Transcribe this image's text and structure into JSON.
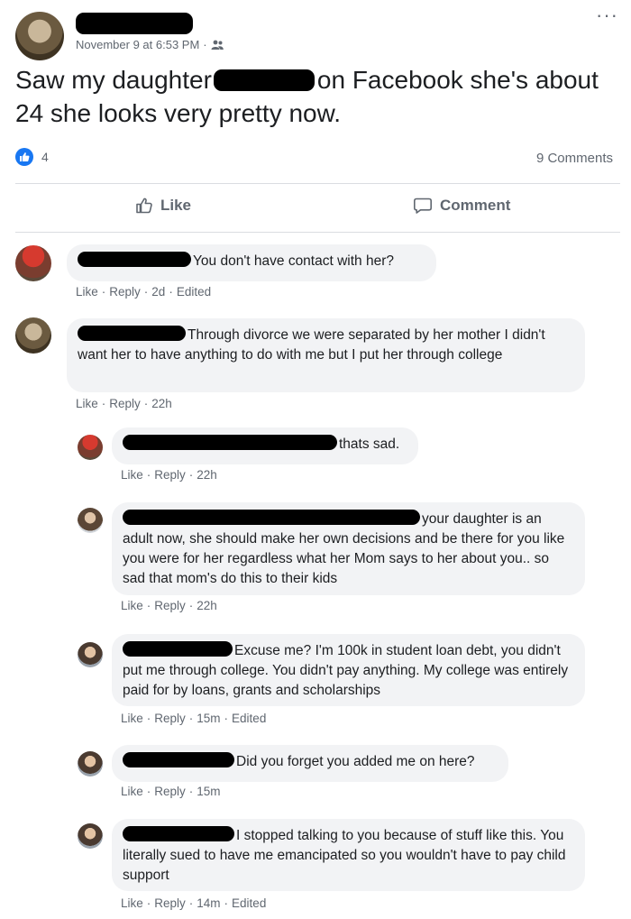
{
  "post": {
    "timestamp": "November 9 at 6:53 PM",
    "privacy_separator": "·",
    "text_before": "Saw my daughter",
    "text_after": "on Facebook she's about 24 she looks very pretty now.",
    "like_count": "4",
    "comment_count": "9 Comments",
    "more_label": "···"
  },
  "actions": {
    "like": "Like",
    "comment": "Comment"
  },
  "comments": [
    {
      "text": "You don't have contact with her?",
      "meta": [
        "Like",
        "Reply",
        "2d",
        "Edited"
      ]
    },
    {
      "text": "Through divorce we were separated by her mother I didn't want her to have anything to do with me but I put her through college",
      "meta": [
        "Like",
        "Reply",
        "22h"
      ]
    },
    {
      "text": "thats sad.",
      "meta": [
        "Like",
        "Reply",
        "22h"
      ]
    },
    {
      "text": "your daughter is an adult now, she should make her own decisions and be there for you like you were for her regardless what her Mom says to her about you.. so sad that mom's do this to their kids",
      "meta": [
        "Like",
        "Reply",
        "22h"
      ]
    },
    {
      "text": "Excuse me? I'm 100k in student loan debt, you didn't put me through college. You didn't pay anything. My college was entirely paid for by loans, grants and scholarships",
      "meta": [
        "Like",
        "Reply",
        "15m",
        "Edited"
      ]
    },
    {
      "text": "Did you forget you added me on here?",
      "meta": [
        "Like",
        "Reply",
        "15m"
      ]
    },
    {
      "text": "I stopped talking to you because of stuff like this. You literally sued to have me emancipated so you wouldn't have to pay child support",
      "meta": [
        "Like",
        "Reply",
        "14m",
        "Edited"
      ]
    }
  ],
  "colors": {
    "brand_blue": "#1877f2",
    "bubble_bg": "#f2f3f5",
    "meta_gray": "#606770"
  }
}
